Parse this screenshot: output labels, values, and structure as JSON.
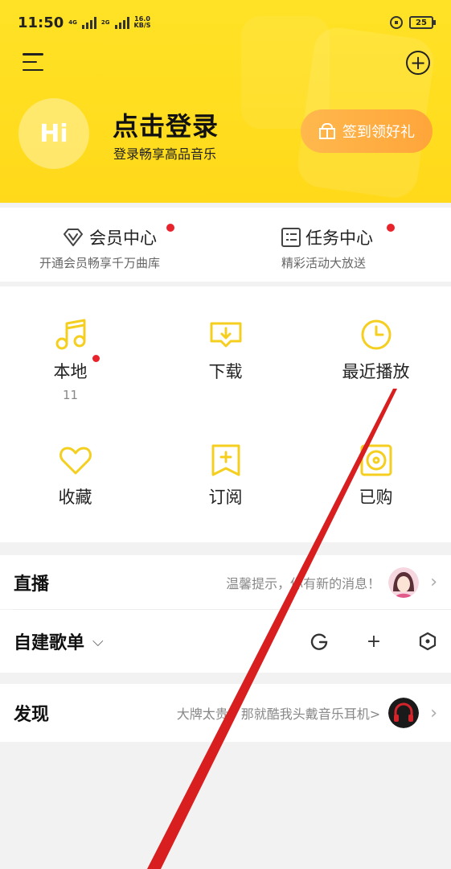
{
  "status_bar": {
    "time": "11:50",
    "network_tag1": "4G",
    "network_tag2": "2G",
    "speed_value": "16.0",
    "speed_unit": "KB/S",
    "battery": "25"
  },
  "header": {
    "avatar_text": "Hi",
    "login_title": "点击登录",
    "login_subtitle": "登录畅享高品音乐",
    "sign_in_button": "签到领好礼"
  },
  "member_card": {
    "vip_title": "会员中心",
    "vip_subtitle": "开通会员畅享千万曲库",
    "task_title": "任务中心",
    "task_subtitle": "精彩活动大放送"
  },
  "grid": {
    "items": [
      {
        "label": "本地",
        "count": "11"
      },
      {
        "label": "下载"
      },
      {
        "label": "最近播放"
      },
      {
        "label": "收藏"
      },
      {
        "label": "订阅"
      },
      {
        "label": "已购"
      }
    ]
  },
  "live_row": {
    "title": "直播",
    "message": "温馨提示，你有新的消息！"
  },
  "playlist_row": {
    "title": "自建歌单"
  },
  "discover_row": {
    "title": "发现",
    "message": "大牌太贵？那就酷我头戴音乐耳机>"
  },
  "colors": {
    "header_yellow": "#ffe226",
    "accent_icon_yellow": "#f5cf1f",
    "sign_button_orange": "#ffa53a",
    "notification_red": "#e8232c",
    "annotation_red": "#d81e1e"
  }
}
